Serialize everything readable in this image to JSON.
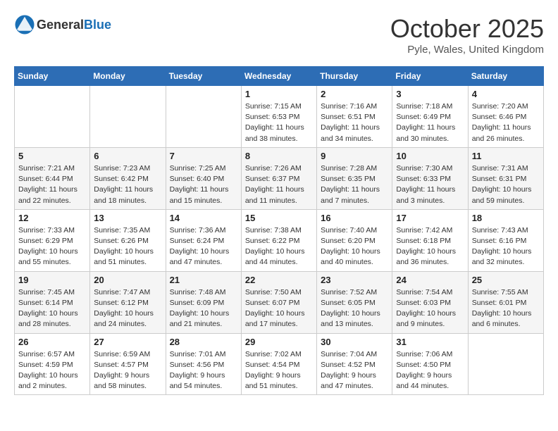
{
  "header": {
    "logo_general": "General",
    "logo_blue": "Blue",
    "month": "October 2025",
    "location": "Pyle, Wales, United Kingdom"
  },
  "days_of_week": [
    "Sunday",
    "Monday",
    "Tuesday",
    "Wednesday",
    "Thursday",
    "Friday",
    "Saturday"
  ],
  "weeks": [
    [
      {
        "day": "",
        "info": ""
      },
      {
        "day": "",
        "info": ""
      },
      {
        "day": "",
        "info": ""
      },
      {
        "day": "1",
        "info": "Sunrise: 7:15 AM\nSunset: 6:53 PM\nDaylight: 11 hours\nand 38 minutes."
      },
      {
        "day": "2",
        "info": "Sunrise: 7:16 AM\nSunset: 6:51 PM\nDaylight: 11 hours\nand 34 minutes."
      },
      {
        "day": "3",
        "info": "Sunrise: 7:18 AM\nSunset: 6:49 PM\nDaylight: 11 hours\nand 30 minutes."
      },
      {
        "day": "4",
        "info": "Sunrise: 7:20 AM\nSunset: 6:46 PM\nDaylight: 11 hours\nand 26 minutes."
      }
    ],
    [
      {
        "day": "5",
        "info": "Sunrise: 7:21 AM\nSunset: 6:44 PM\nDaylight: 11 hours\nand 22 minutes."
      },
      {
        "day": "6",
        "info": "Sunrise: 7:23 AM\nSunset: 6:42 PM\nDaylight: 11 hours\nand 18 minutes."
      },
      {
        "day": "7",
        "info": "Sunrise: 7:25 AM\nSunset: 6:40 PM\nDaylight: 11 hours\nand 15 minutes."
      },
      {
        "day": "8",
        "info": "Sunrise: 7:26 AM\nSunset: 6:37 PM\nDaylight: 11 hours\nand 11 minutes."
      },
      {
        "day": "9",
        "info": "Sunrise: 7:28 AM\nSunset: 6:35 PM\nDaylight: 11 hours\nand 7 minutes."
      },
      {
        "day": "10",
        "info": "Sunrise: 7:30 AM\nSunset: 6:33 PM\nDaylight: 11 hours\nand 3 minutes."
      },
      {
        "day": "11",
        "info": "Sunrise: 7:31 AM\nSunset: 6:31 PM\nDaylight: 10 hours\nand 59 minutes."
      }
    ],
    [
      {
        "day": "12",
        "info": "Sunrise: 7:33 AM\nSunset: 6:29 PM\nDaylight: 10 hours\nand 55 minutes."
      },
      {
        "day": "13",
        "info": "Sunrise: 7:35 AM\nSunset: 6:26 PM\nDaylight: 10 hours\nand 51 minutes."
      },
      {
        "day": "14",
        "info": "Sunrise: 7:36 AM\nSunset: 6:24 PM\nDaylight: 10 hours\nand 47 minutes."
      },
      {
        "day": "15",
        "info": "Sunrise: 7:38 AM\nSunset: 6:22 PM\nDaylight: 10 hours\nand 44 minutes."
      },
      {
        "day": "16",
        "info": "Sunrise: 7:40 AM\nSunset: 6:20 PM\nDaylight: 10 hours\nand 40 minutes."
      },
      {
        "day": "17",
        "info": "Sunrise: 7:42 AM\nSunset: 6:18 PM\nDaylight: 10 hours\nand 36 minutes."
      },
      {
        "day": "18",
        "info": "Sunrise: 7:43 AM\nSunset: 6:16 PM\nDaylight: 10 hours\nand 32 minutes."
      }
    ],
    [
      {
        "day": "19",
        "info": "Sunrise: 7:45 AM\nSunset: 6:14 PM\nDaylight: 10 hours\nand 28 minutes."
      },
      {
        "day": "20",
        "info": "Sunrise: 7:47 AM\nSunset: 6:12 PM\nDaylight: 10 hours\nand 24 minutes."
      },
      {
        "day": "21",
        "info": "Sunrise: 7:48 AM\nSunset: 6:09 PM\nDaylight: 10 hours\nand 21 minutes."
      },
      {
        "day": "22",
        "info": "Sunrise: 7:50 AM\nSunset: 6:07 PM\nDaylight: 10 hours\nand 17 minutes."
      },
      {
        "day": "23",
        "info": "Sunrise: 7:52 AM\nSunset: 6:05 PM\nDaylight: 10 hours\nand 13 minutes."
      },
      {
        "day": "24",
        "info": "Sunrise: 7:54 AM\nSunset: 6:03 PM\nDaylight: 10 hours\nand 9 minutes."
      },
      {
        "day": "25",
        "info": "Sunrise: 7:55 AM\nSunset: 6:01 PM\nDaylight: 10 hours\nand 6 minutes."
      }
    ],
    [
      {
        "day": "26",
        "info": "Sunrise: 6:57 AM\nSunset: 4:59 PM\nDaylight: 10 hours\nand 2 minutes."
      },
      {
        "day": "27",
        "info": "Sunrise: 6:59 AM\nSunset: 4:57 PM\nDaylight: 9 hours\nand 58 minutes."
      },
      {
        "day": "28",
        "info": "Sunrise: 7:01 AM\nSunset: 4:56 PM\nDaylight: 9 hours\nand 54 minutes."
      },
      {
        "day": "29",
        "info": "Sunrise: 7:02 AM\nSunset: 4:54 PM\nDaylight: 9 hours\nand 51 minutes."
      },
      {
        "day": "30",
        "info": "Sunrise: 7:04 AM\nSunset: 4:52 PM\nDaylight: 9 hours\nand 47 minutes."
      },
      {
        "day": "31",
        "info": "Sunrise: 7:06 AM\nSunset: 4:50 PM\nDaylight: 9 hours\nand 44 minutes."
      },
      {
        "day": "",
        "info": ""
      }
    ]
  ]
}
